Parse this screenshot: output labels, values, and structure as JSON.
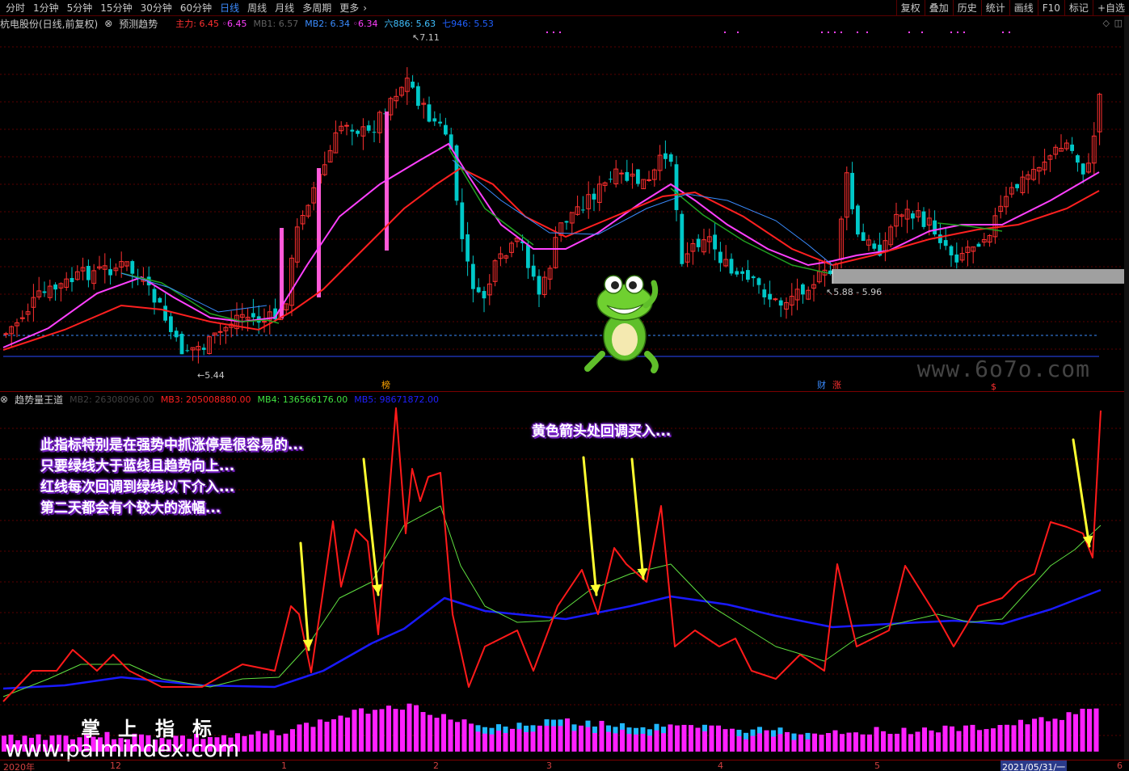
{
  "toolbar": {
    "periods": [
      "分时",
      "1分钟",
      "5分钟",
      "15分钟",
      "30分钟",
      "60分钟",
      "日线",
      "周线",
      "月线",
      "多周期",
      "更多"
    ],
    "active_period": "日线",
    "right_buttons": [
      "复权",
      "叠加",
      "历史",
      "统计",
      "画线",
      "F10",
      "标记",
      "+自选"
    ]
  },
  "main_info": {
    "stock": "杭电股份(日线,前复权)",
    "indicator_name": "预测趋势",
    "zhuli_label": "主力:",
    "zhuli_val1": "6.45",
    "zhuli_val2": "6.45",
    "mb1": "MB1: 6.57",
    "mb2_label": "MB2: 6.34",
    "mb2_val": "6.34",
    "six886": "六886: 5.63",
    "seven946": "七946: 5.53"
  },
  "main_labels": {
    "high": "7.11",
    "low": "5.44",
    "range": "5.88 - 5.96",
    "bang": "榜",
    "cai": "财",
    "zhang": "涨",
    "dollar": "$"
  },
  "sub_info": {
    "name": "趋势量王道",
    "mb2": "MB2: 26308096.00",
    "mb3": "MB3: 205008880.00",
    "mb4": "MB4: 136566176.00",
    "mb5": "MB5: 98671872.00"
  },
  "annotations": {
    "left": [
      "此指标特别是在强势中抓涨停是很容易的...",
      "只要绿线大于蓝线且趋势向上...",
      "红线每次回调到绿线以下介入...",
      "第二天都会有个较大的涨幅..."
    ],
    "middle": "黄色箭头处回调买入..."
  },
  "watermarks": {
    "big": "掌上指标",
    "url": "www.palmindex.com",
    "url2": "www.6o7o.com"
  },
  "xaxis": {
    "labels": [
      "2020年",
      "12",
      "1",
      "2",
      "3",
      "4",
      "5",
      "6"
    ],
    "date_box": "2021/05/31/一"
  },
  "colors": {
    "up": "#ff3030",
    "down": "#00c8c8",
    "ma_magenta": "#ff40ff",
    "ma_red": "#ff2020",
    "ma_green": "#20a020",
    "ma_blue": "#3a8cff",
    "vol_red": "#ff0000",
    "vol_green": "#40e040",
    "vol_blue": "#2020ff"
  }
}
